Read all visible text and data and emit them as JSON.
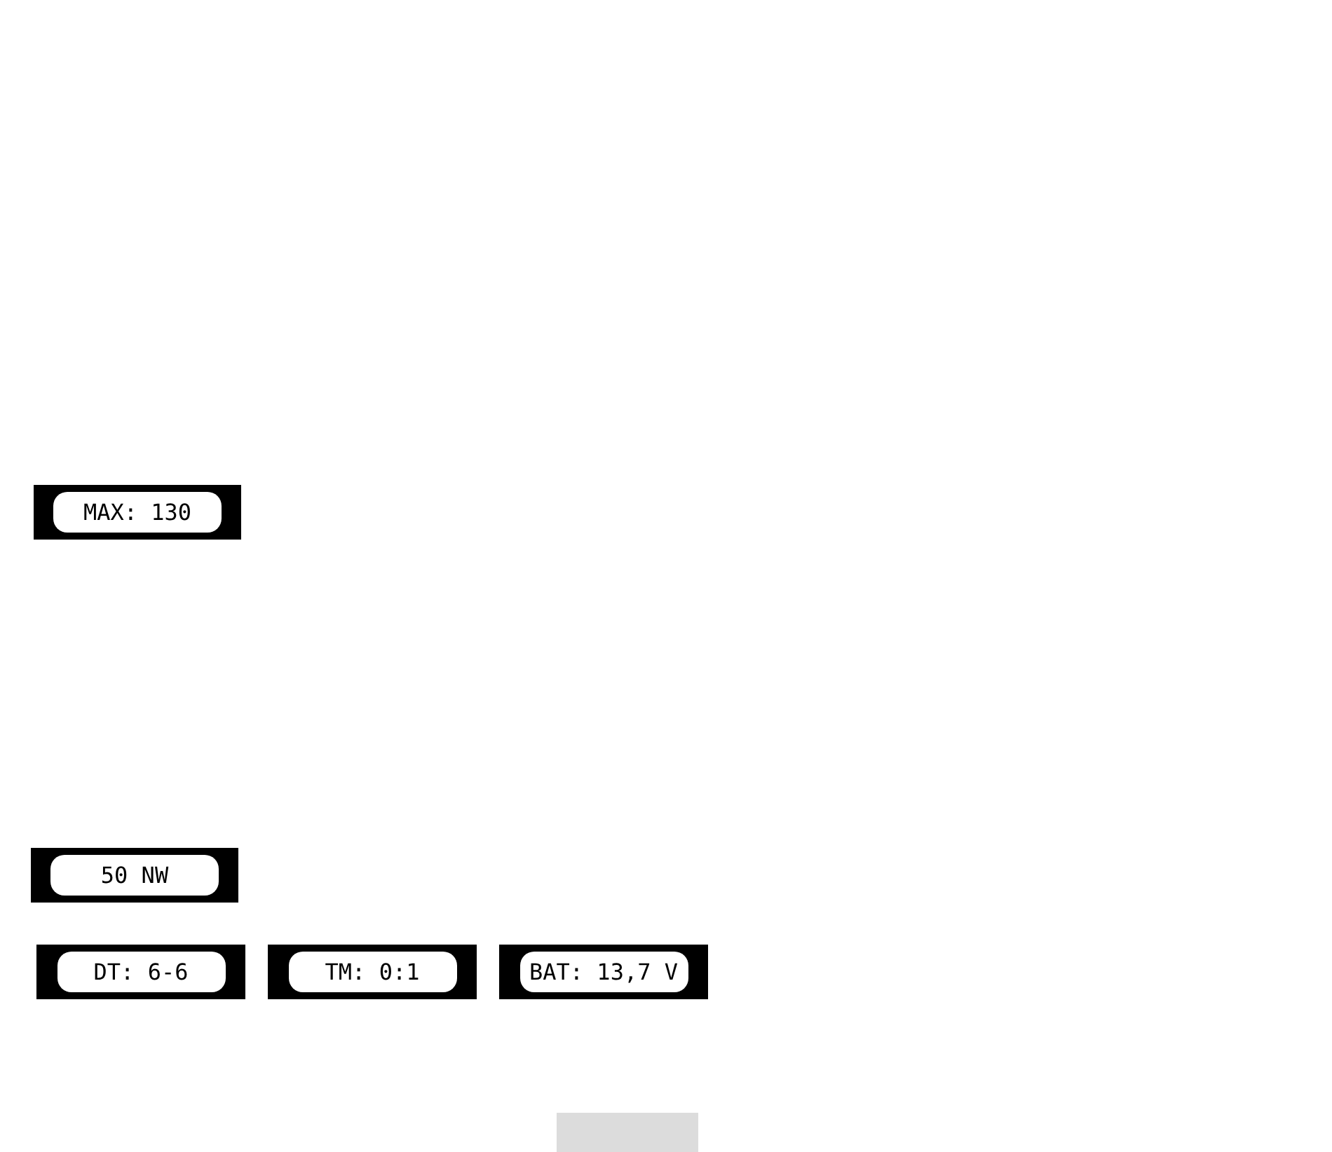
{
  "max_display": {
    "text": "MAX: 130"
  },
  "direction_display": {
    "text": "50 NW"
  },
  "status_displays": [
    {
      "text": "DT: 6-6"
    },
    {
      "text": "TM: 0:1"
    },
    {
      "text": "BAT: 13,7 V"
    }
  ]
}
